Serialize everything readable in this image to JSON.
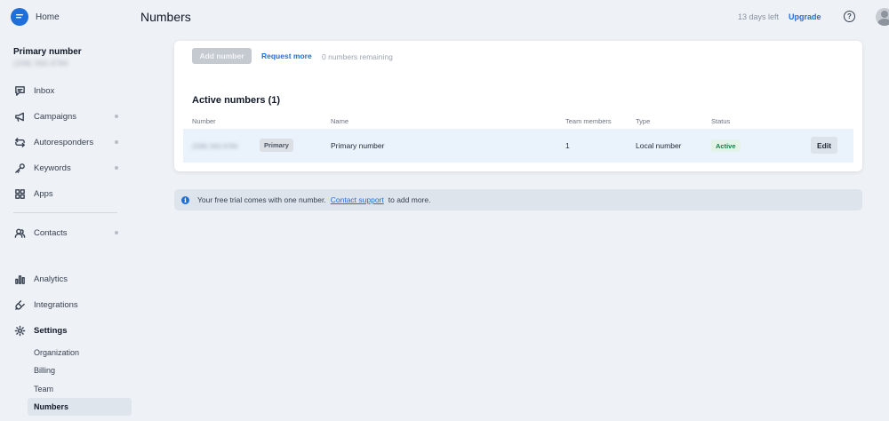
{
  "sidebar": {
    "home_label": "Home",
    "primary_number_title": "Primary number",
    "primary_number_phone": "(208) 343-3784",
    "items": [
      {
        "label": "Inbox",
        "icon": "inbox-icon",
        "dot": false
      },
      {
        "label": "Campaigns",
        "icon": "megaphone-icon",
        "dot": true
      },
      {
        "label": "Autoresponders",
        "icon": "autoresponder-icon",
        "dot": true
      },
      {
        "label": "Keywords",
        "icon": "key-icon",
        "dot": true
      },
      {
        "label": "Apps",
        "icon": "apps-grid-icon",
        "dot": false
      },
      {
        "label": "Contacts",
        "icon": "contacts-icon",
        "dot": true
      },
      {
        "label": "Analytics",
        "icon": "analytics-icon",
        "dot": false
      },
      {
        "label": "Integrations",
        "icon": "plug-icon",
        "dot": false
      },
      {
        "label": "Settings",
        "icon": "gear-icon",
        "dot": false
      }
    ],
    "settings_sub": [
      "Organization",
      "Billing",
      "Team",
      "Numbers"
    ],
    "active_sub": "Numbers"
  },
  "header": {
    "title": "Numbers",
    "trial_left": "13 days left",
    "upgrade_label": "Upgrade"
  },
  "card": {
    "add_number_label": "Add number",
    "request_more_label": "Request more",
    "remaining_text": "0 numbers remaining",
    "active_title": "Active numbers (1)",
    "columns": [
      "Number",
      "Name",
      "Team members",
      "Type",
      "Status"
    ],
    "rows": [
      {
        "number": "(208) 343-3784",
        "primary_badge": "Primary",
        "name": "Primary number",
        "team_members": "1",
        "type": "Local number",
        "status": "Active",
        "edit_label": "Edit"
      }
    ]
  },
  "banner": {
    "text": "Your free trial comes with one number.",
    "link": "Contact support",
    "text_after": "to add more."
  },
  "colors": {
    "accent": "#1e6fd9",
    "background": "#eef1f5",
    "active_status": "#16804a"
  }
}
